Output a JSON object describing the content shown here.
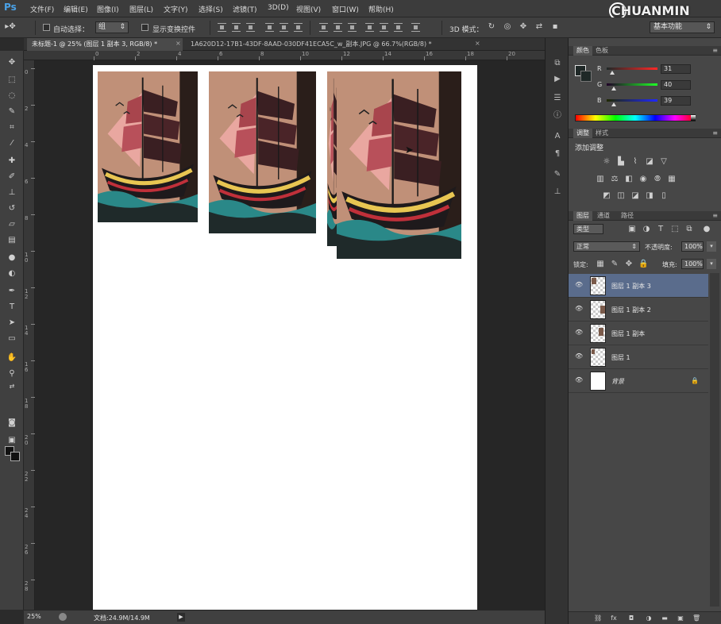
{
  "app": {
    "logo": "Ps",
    "watermark": "CHUANMIN"
  },
  "menu": [
    "文件(F)",
    "编辑(E)",
    "图像(I)",
    "图层(L)",
    "文字(Y)",
    "选择(S)",
    "滤镜(T)",
    "3D(D)",
    "视图(V)",
    "窗口(W)",
    "帮助(H)"
  ],
  "options": {
    "auto_select_label": "自动选择：",
    "auto_select_value": "组",
    "show_transform_label": "显示变换控件",
    "mode_3d_label": "3D 模式：",
    "workspace": "基本功能"
  },
  "tabs": [
    {
      "label": "未标题-1 @ 25% (图层 1 副本 3, RGB/8) *",
      "close": "×"
    },
    {
      "label": "1A620D12-17B1-43DF-8AAD-030DF41ECA5C_w_副本.JPG @ 66.7%(RGB/8) *",
      "close": "×"
    }
  ],
  "ruler": {
    "top_ticks": [
      "0",
      "2",
      "4",
      "6",
      "8",
      "10",
      "12",
      "14",
      "16",
      "18",
      "20"
    ],
    "left_ticks": [
      "0",
      "2",
      "4",
      "6",
      "8",
      "1 0",
      "1 2",
      "1 4",
      "1 6",
      "1 8",
      "2 0",
      "2 2",
      "2 4",
      "2 6",
      "2 8"
    ]
  },
  "status": {
    "zoom": "25%",
    "doc_info": "文档:24.9M/14.9M",
    "arrow": "▶"
  },
  "color_panel": {
    "tabs": [
      "颜色",
      "色板"
    ],
    "channels": [
      {
        "label": "R",
        "value": "31",
        "color": "#e04040"
      },
      {
        "label": "G",
        "value": "40",
        "color": "#40c040"
      },
      {
        "label": "B",
        "value": "39",
        "color": "#4060e0"
      }
    ]
  },
  "adjust_panel": {
    "tabs": [
      "调整",
      "样式"
    ],
    "title": "添加调整"
  },
  "layers_panel": {
    "tabs": [
      "图层",
      "通道",
      "路径"
    ],
    "filter_kind": "类型",
    "blend_mode": "正常",
    "opacity_label": "不透明度:",
    "opacity_value": "100%",
    "lock_label": "锁定:",
    "fill_label": "填充:",
    "fill_value": "100%",
    "layers": [
      {
        "name": "图层 1 副本 3",
        "selected": true,
        "lock": ""
      },
      {
        "name": "图层 1 副本 2",
        "selected": false,
        "lock": ""
      },
      {
        "name": "图层 1 副本",
        "selected": false,
        "lock": ""
      },
      {
        "name": "图层 1",
        "selected": false,
        "lock": ""
      },
      {
        "name": "背景",
        "selected": false,
        "lock": "🔒"
      }
    ]
  },
  "colors": {
    "accent": "#4aa2e8",
    "selected_layer": "#5a6c8c",
    "foreground": "#1f2827"
  }
}
